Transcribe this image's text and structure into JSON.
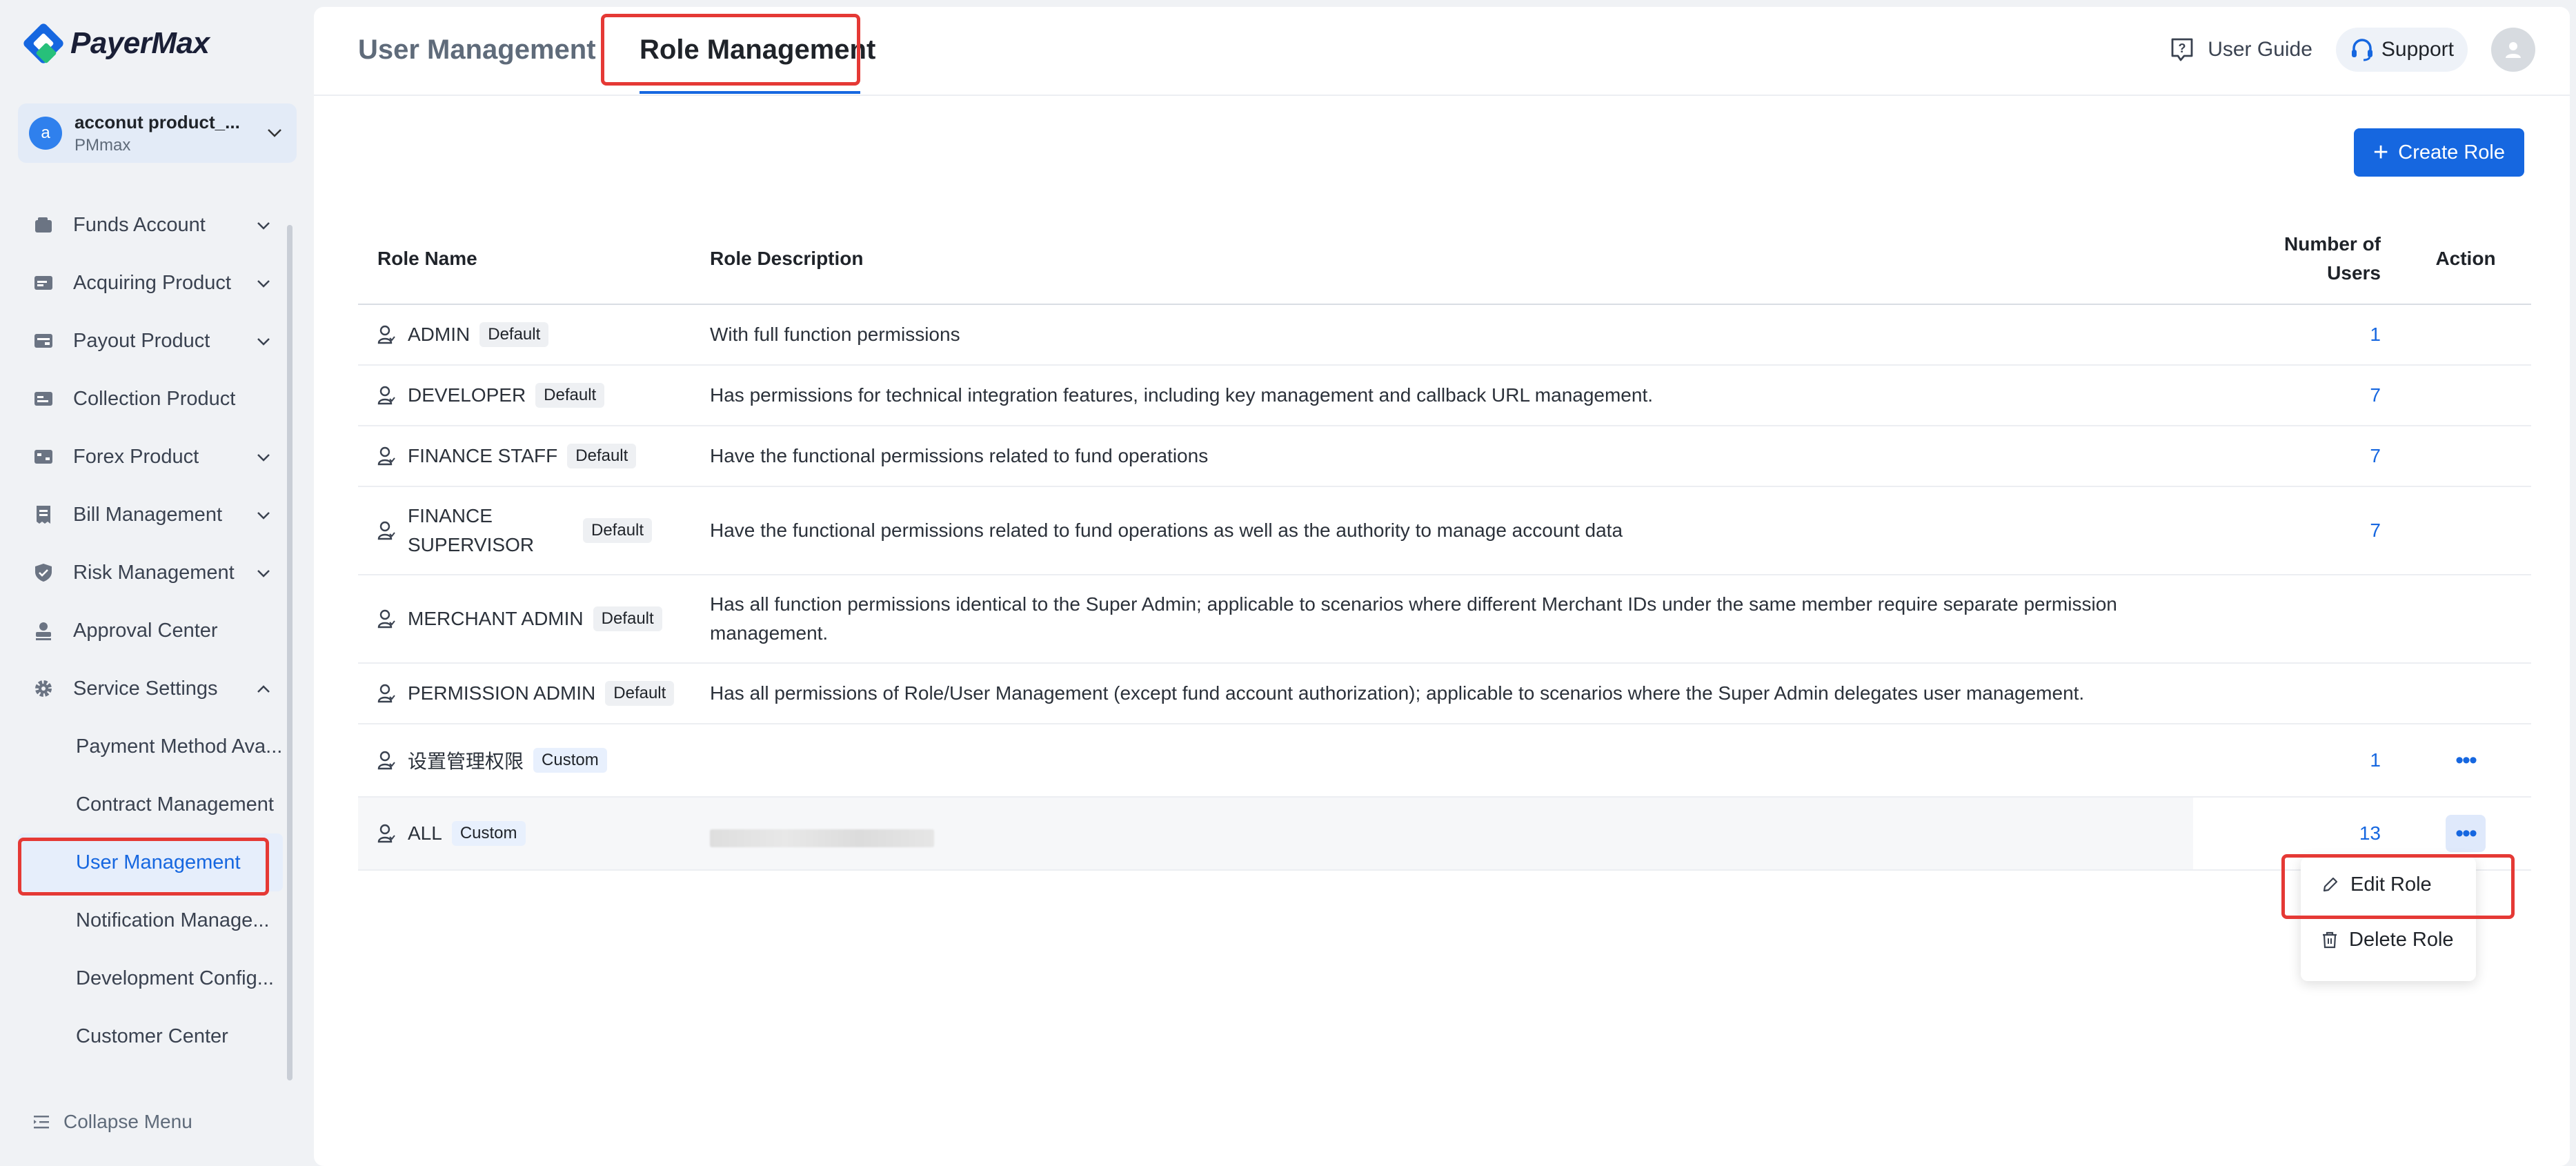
{
  "brand": {
    "name": "PayerMax"
  },
  "account": {
    "avatar_letter": "a",
    "name": "acconut product_...",
    "org": "PMmax"
  },
  "sidebar": {
    "items": [
      {
        "label": "Funds Account",
        "icon": "wallet-icon",
        "has_chevron": true
      },
      {
        "label": "Acquiring Product",
        "icon": "card-icon",
        "has_chevron": true
      },
      {
        "label": "Payout Product",
        "icon": "payout-icon",
        "has_chevron": true
      },
      {
        "label": "Collection Product",
        "icon": "collection-icon",
        "has_chevron": false
      },
      {
        "label": "Forex Product",
        "icon": "forex-icon",
        "has_chevron": true
      },
      {
        "label": "Bill Management",
        "icon": "bill-icon",
        "has_chevron": true
      },
      {
        "label": "Risk Management",
        "icon": "shield-icon",
        "has_chevron": true
      },
      {
        "label": "Approval Center",
        "icon": "approval-icon",
        "has_chevron": false
      },
      {
        "label": "Service Settings",
        "icon": "gear-icon",
        "has_chevron": true,
        "expanded": true
      }
    ],
    "sub_items": [
      {
        "label": "Payment Method Ava..."
      },
      {
        "label": "Contract Management"
      },
      {
        "label": "User Management",
        "active": true
      },
      {
        "label": "Notification Manage..."
      },
      {
        "label": "Development Config..."
      },
      {
        "label": "Customer Center"
      }
    ],
    "collapse_label": "Collapse Menu"
  },
  "header": {
    "tabs": [
      {
        "label": "User Management",
        "active": false
      },
      {
        "label": "Role Management",
        "active": true
      }
    ],
    "user_guide": "User Guide",
    "support": "Support"
  },
  "toolbar": {
    "create_role": "Create Role"
  },
  "table": {
    "headers": {
      "name": "Role Name",
      "desc": "Role Description",
      "num": "Number of Users",
      "action": "Action"
    },
    "rows": [
      {
        "name": "ADMIN",
        "badge": "Default",
        "desc": "With full function permissions",
        "num": "1"
      },
      {
        "name": "DEVELOPER",
        "badge": "Default",
        "desc": "Has permissions for technical integration features, including key management and callback URL management.",
        "num": "7"
      },
      {
        "name": "FINANCE STAFF",
        "badge": "Default",
        "desc": "Have the functional permissions related to fund operations",
        "num": "7"
      },
      {
        "name": "FINANCE SUPERVISOR",
        "badge": "Default",
        "desc": "Have the functional permissions related to fund operations as well as the authority to manage account data",
        "num": "7"
      },
      {
        "name": "MERCHANT ADMIN",
        "badge": "Default",
        "desc": "Has all function permissions identical to the Super Admin; applicable to scenarios where different Merchant IDs under the same member require separate permission management.",
        "num": ""
      },
      {
        "name": "PERMISSION ADMIN",
        "badge": "Default",
        "desc": "Has all permissions of Role/User Management (except fund account authorization); applicable to scenarios where the Super Admin delegates user management.",
        "num": ""
      },
      {
        "name": "设置管理权限",
        "badge": "Custom",
        "desc": "",
        "num": "1"
      },
      {
        "name": "ALL",
        "badge": "Custom",
        "desc": "",
        "num": "13"
      }
    ]
  },
  "dropdown": {
    "edit": "Edit Role",
    "delete": "Delete Role"
  },
  "colors": {
    "primary": "#1667e0",
    "highlight": "#e53935"
  }
}
